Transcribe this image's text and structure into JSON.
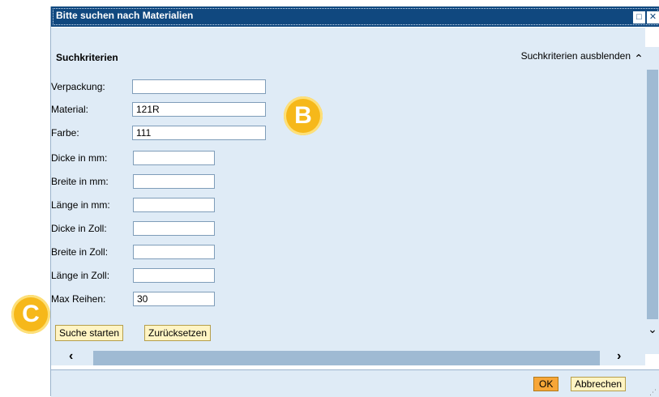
{
  "dialog": {
    "title": "Bitte suchen nach Materialien",
    "maximize_glyph": "□",
    "close_glyph": "✕"
  },
  "criteria": {
    "header": "Suchkriterien",
    "hide_link": "Suchkriterien ausblenden",
    "fields": [
      {
        "label": "Verpackung:",
        "value": ""
      },
      {
        "label": "Material:",
        "value": "121R"
      },
      {
        "label": "Farbe:",
        "value": "111"
      },
      {
        "label": "Dicke in mm:",
        "value": ""
      },
      {
        "label": "Breite in mm:",
        "value": ""
      },
      {
        "label": "Länge in mm:",
        "value": ""
      },
      {
        "label": "Dicke in Zoll:",
        "value": ""
      },
      {
        "label": "Breite in Zoll:",
        "value": ""
      },
      {
        "label": "Länge in Zoll:",
        "value": ""
      },
      {
        "label": "Max Reihen:",
        "value": "30"
      }
    ],
    "search_button": "Suche starten",
    "reset_button": "Zurücksetzen"
  },
  "footer": {
    "ok_button": "OK",
    "cancel_button": "Abbrechen"
  },
  "callouts": {
    "b": "B",
    "c": "C"
  },
  "icons": {
    "scroll_up": "chevron-up-icon",
    "scroll_down": "chevron-down-icon",
    "scroll_left": "chevron-left-icon",
    "scroll_right": "chevron-right-icon"
  }
}
